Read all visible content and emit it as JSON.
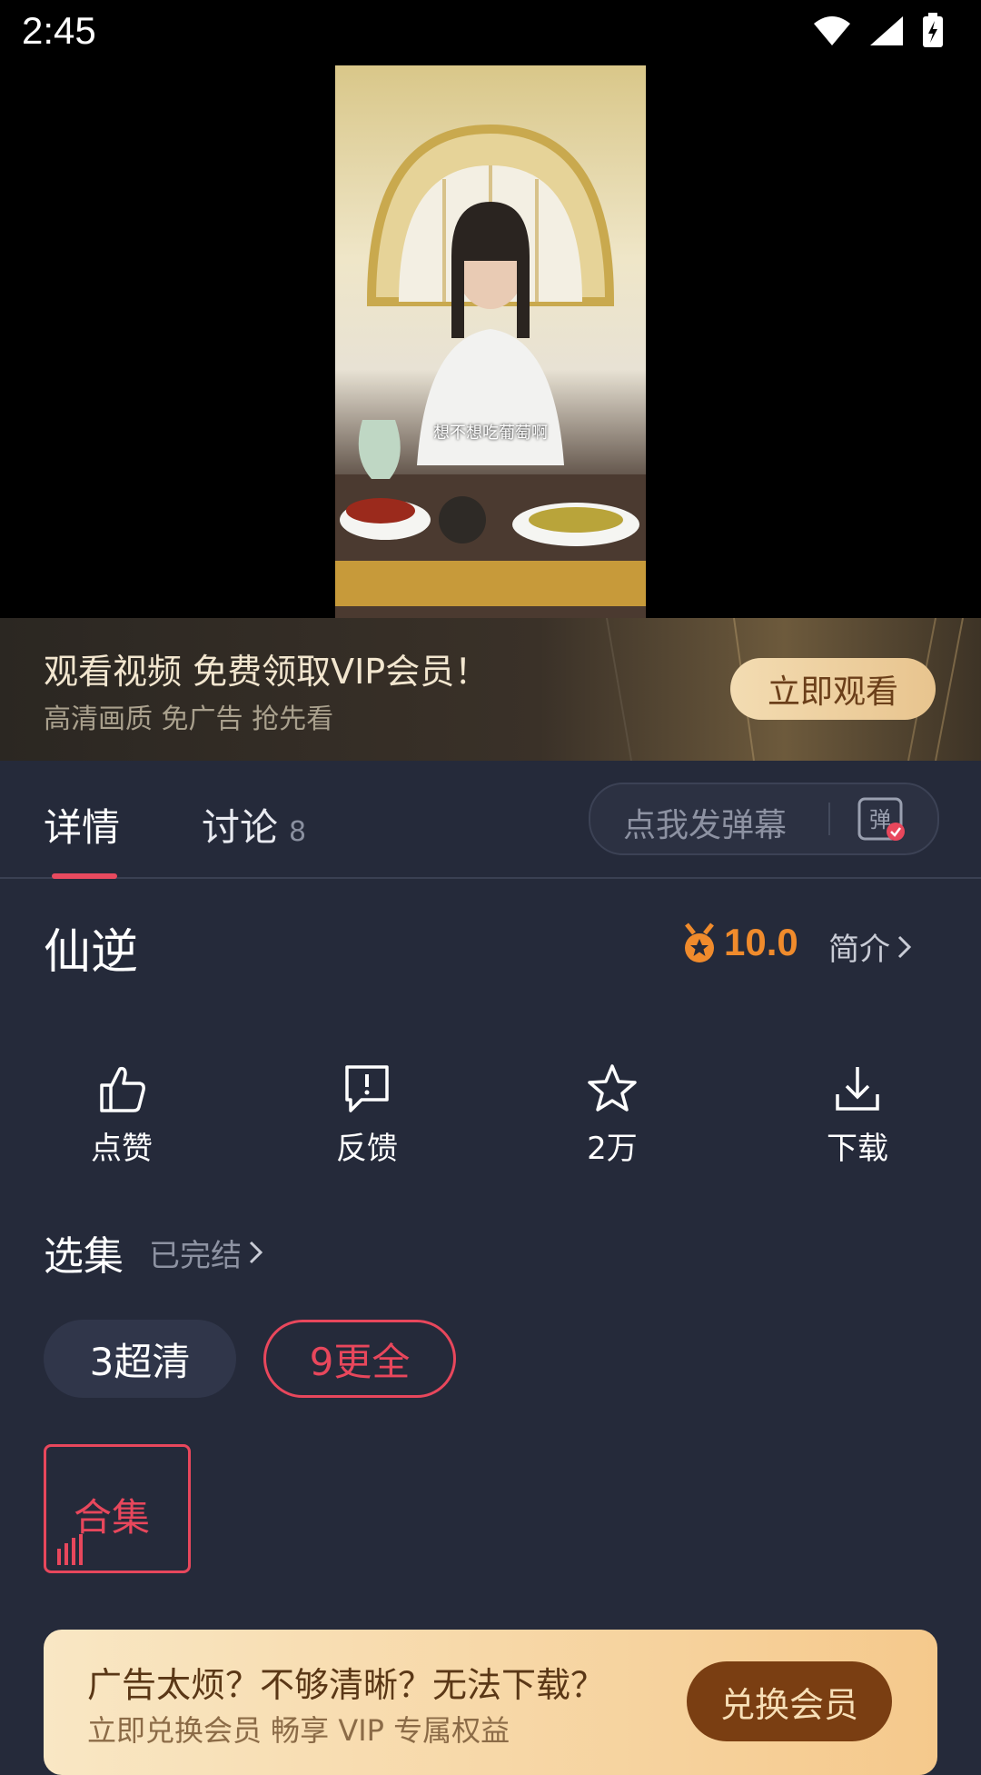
{
  "status_bar": {
    "time": "2:45"
  },
  "video": {
    "subtitle": "想不想吃葡萄啊"
  },
  "promo": {
    "title": "观看视频 免费领取VIP会员！",
    "subtitle": "高清画质 免广告 抢先看",
    "button": "立即观看"
  },
  "tabs": [
    {
      "label": "详情"
    },
    {
      "label": "讨论",
      "count": "8"
    }
  ],
  "danmaku": {
    "placeholder": "点我发弹幕",
    "icon_text": "弹"
  },
  "show": {
    "title": "仙逆",
    "rating": "10.0",
    "intro_link": "简介"
  },
  "actions": [
    {
      "label": "点赞",
      "icon": "thumbs-up-icon"
    },
    {
      "label": "反馈",
      "icon": "feedback-icon"
    },
    {
      "label": "2万",
      "icon": "star-icon"
    },
    {
      "label": "下载",
      "icon": "download-icon"
    }
  ],
  "episodes": {
    "title": "选集",
    "status": "已完结"
  },
  "sources": [
    {
      "label": "3超清",
      "active": false
    },
    {
      "label": "9更全",
      "active": true
    }
  ],
  "collection": {
    "label": "合集"
  },
  "vip_banner": {
    "title": "广告太烦？不够清晰？无法下载？",
    "subtitle": "立即兑换会员 畅享 VIP 专属权益",
    "button": "兑换会员"
  },
  "colors": {
    "accent": "#e8475c",
    "rating": "#f08b2c",
    "background": "#252a3a"
  }
}
